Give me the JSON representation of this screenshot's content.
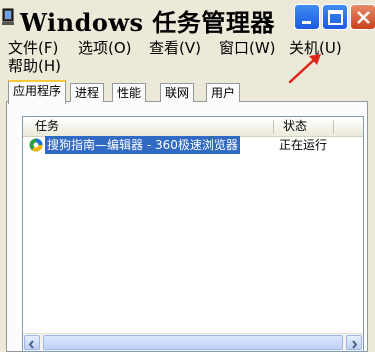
{
  "window": {
    "title": "Windows 任务管理器"
  },
  "menu": {
    "items": [
      {
        "label": "文件(F)"
      },
      {
        "label": "选项(O)"
      },
      {
        "label": "查看(V)"
      },
      {
        "label": "窗口(W)"
      },
      {
        "label": "关机(U)"
      },
      {
        "label": "帮助(H)"
      }
    ]
  },
  "tabs": [
    {
      "label": "应用程序",
      "active": true
    },
    {
      "label": "进程",
      "active": false
    },
    {
      "label": "性能",
      "active": false
    },
    {
      "label": "联网",
      "active": false
    },
    {
      "label": "用户",
      "active": false
    }
  ],
  "list": {
    "columns": {
      "task": "任务",
      "status": "状态"
    },
    "rows": [
      {
        "task": "搜狗指南—编辑器 - 360极速浏览器",
        "status": "正在运行",
        "selected": true
      }
    ]
  },
  "annotation": {
    "arrow_color": "#e0261b"
  }
}
